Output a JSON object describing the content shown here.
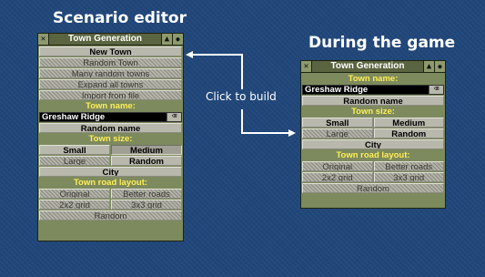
{
  "headings": {
    "left": "Scenario editor",
    "right": "During the game"
  },
  "click_label": "Click to build",
  "editor": {
    "title": "Town Generation",
    "close_icon": "✕",
    "shade_icon": "▲",
    "pin_icon": "📌",
    "actions": [
      {
        "label": "New Town",
        "state": "active"
      },
      {
        "label": "Random Town",
        "state": "disabled"
      },
      {
        "label": "Many random towns",
        "state": "disabled"
      },
      {
        "label": "Expand all towns",
        "state": "disabled"
      },
      {
        "label": "Import from file",
        "state": "disabled"
      }
    ],
    "town_name_label": "Town name:",
    "town_name_value": "Greshaw Ridge",
    "clear_icon": "⌫",
    "random_name": "Random name",
    "town_size_label": "Town size:",
    "size_small": "Small",
    "size_medium": "Medium",
    "size_large": "Large",
    "size_random": "Random",
    "city": "City",
    "road_layout_label": "Town road layout:",
    "road_original": "Original",
    "road_better": "Better roads",
    "road_2x2": "2x2 grid",
    "road_3x3": "3x3 grid",
    "road_random": "Random"
  },
  "game": {
    "title": "Town Generation",
    "town_name_label": "Town name:",
    "town_name_value": "Greshaw Ridge",
    "random_name": "Random name",
    "town_size_label": "Town size:",
    "size_small": "Small",
    "size_medium": "Medium",
    "size_large": "Large",
    "size_random": "Random",
    "city": "City",
    "road_layout_label": "Town road layout:",
    "road_original": "Original",
    "road_better": "Better roads",
    "road_2x2": "2x2 grid",
    "road_3x3": "3x3 grid",
    "road_random": "Random"
  },
  "colors": {
    "background": "#21477a",
    "panel": "#7d8a5d",
    "label_yellow": "#ffee55",
    "arrow": "#ffffff"
  }
}
